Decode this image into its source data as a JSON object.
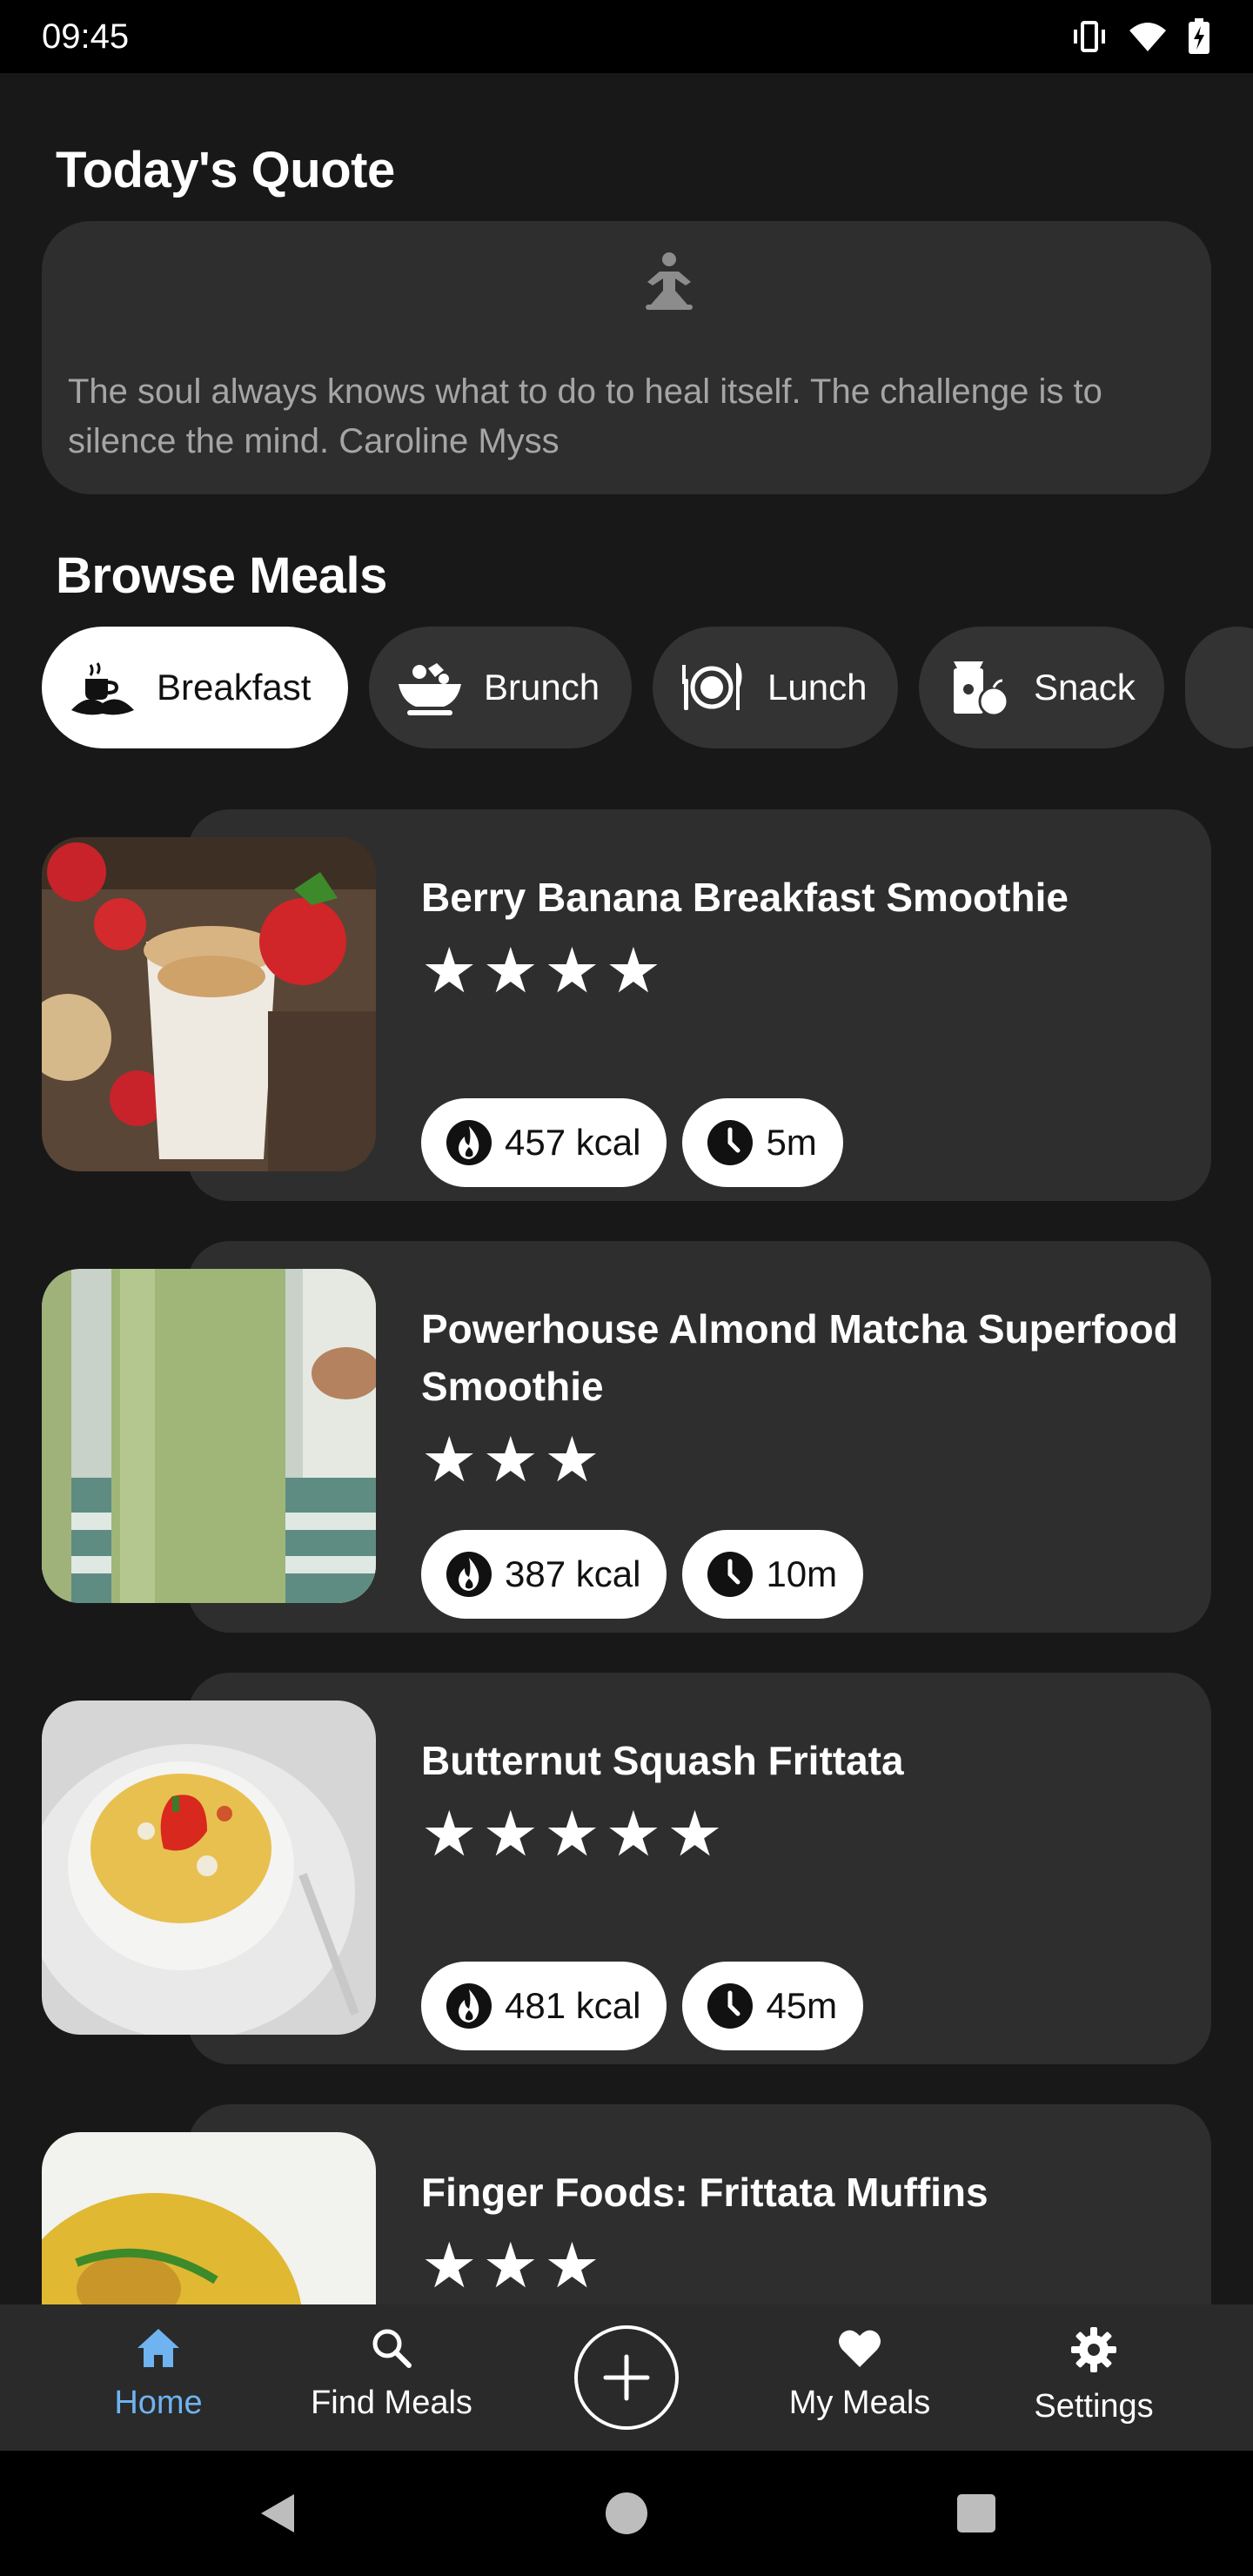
{
  "status": {
    "time": "09:45"
  },
  "quote": {
    "title": "Today's Quote",
    "text": "The soul always knows what to do to heal itself. The challenge is to silence the mind. Caroline Myss"
  },
  "browse": {
    "title": "Browse Meals",
    "categories": [
      {
        "label": "Breakfast",
        "icon": "breakfast-icon",
        "active": true
      },
      {
        "label": "Brunch",
        "icon": "brunch-icon",
        "active": false
      },
      {
        "label": "Lunch",
        "icon": "lunch-icon",
        "active": false
      },
      {
        "label": "Snack",
        "icon": "snack-icon",
        "active": false
      }
    ]
  },
  "meals": [
    {
      "title": "Berry Banana Breakfast Smoothie",
      "rating": 4,
      "stars": "★★★★",
      "kcal": "457 kcal",
      "time": "5m"
    },
    {
      "title": "Powerhouse Almond Matcha Superfood Smoothie",
      "rating": 3,
      "stars": "★★★",
      "kcal": "387 kcal",
      "time": "10m"
    },
    {
      "title": "Butternut Squash Frittata",
      "rating": 5,
      "stars": "★★★★★",
      "kcal": "481 kcal",
      "time": "45m"
    },
    {
      "title": "Finger Foods: Frittata Muffins",
      "rating": 3,
      "stars": "★★★"
    }
  ],
  "nav": {
    "home": "Home",
    "find": "Find Meals",
    "my_meals": "My Meals",
    "settings": "Settings"
  },
  "colors": {
    "accent": "#6fb3f0",
    "card": "#2e2e2e",
    "background": "#181818"
  }
}
